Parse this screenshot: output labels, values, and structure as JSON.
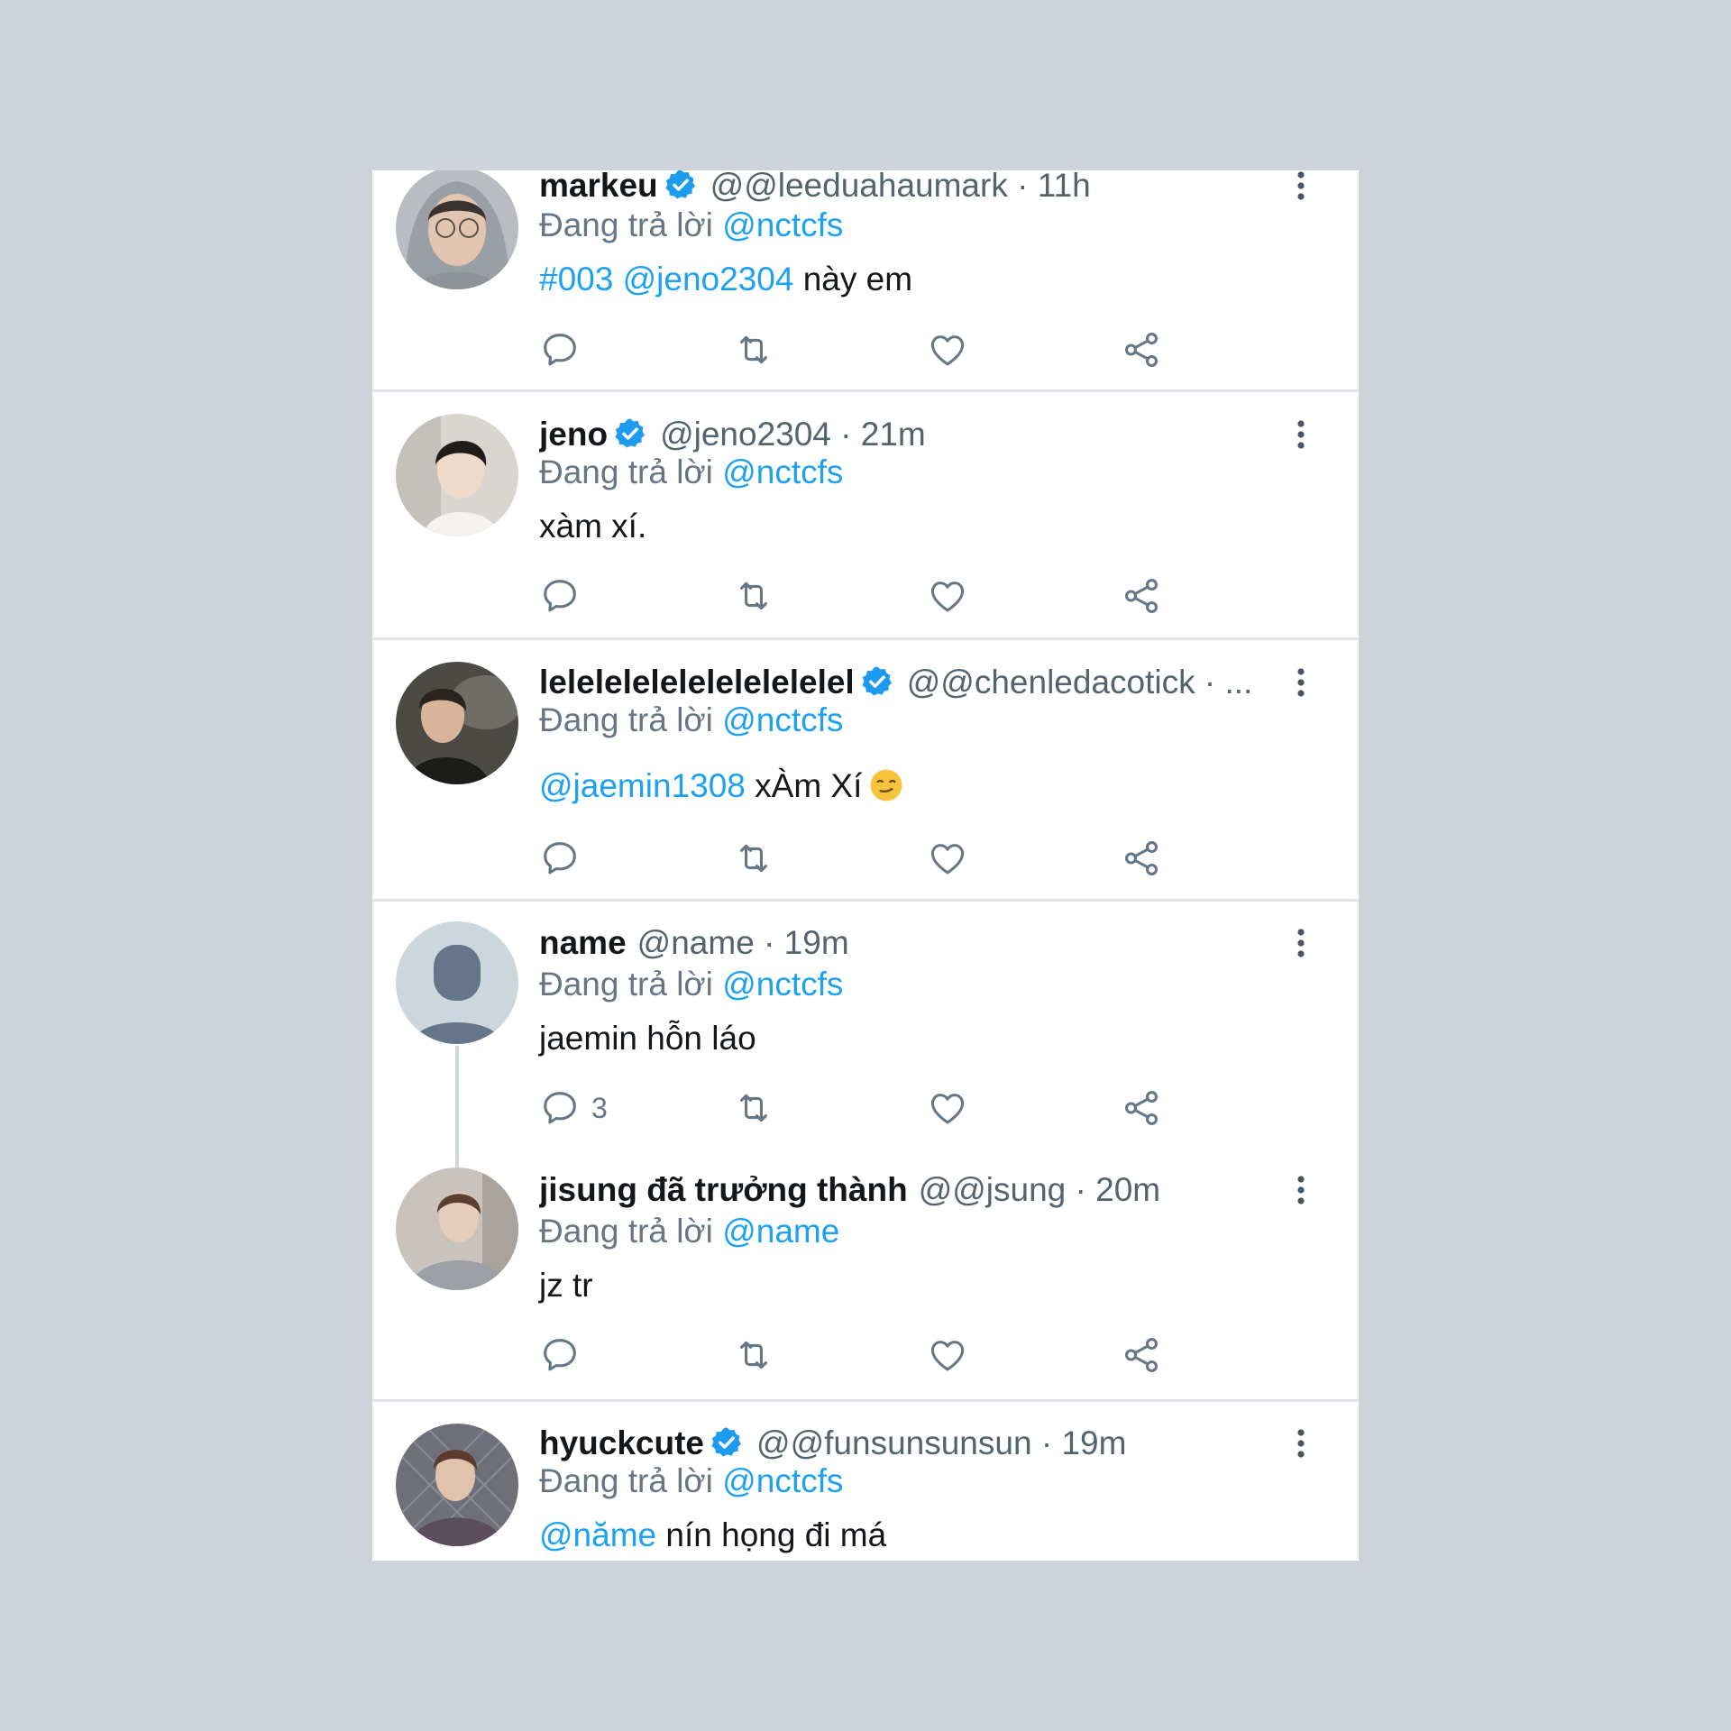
{
  "colors": {
    "link": "#1da1f2",
    "verified": "#1d9bf0",
    "icon": "#657786"
  },
  "tweets": [
    {
      "name": "markeu",
      "verified": true,
      "handle": "@@leeduahaumark",
      "time": "11h",
      "reply_prefix": "Đang trả lời",
      "reply_to": "@nctcfs",
      "body_links": "#003 @jeno2304",
      "body_text": "này em",
      "reply_count": ""
    },
    {
      "name": "jeno",
      "verified": true,
      "handle": "@jeno2304",
      "time": "21m",
      "reply_prefix": "Đang trả lời",
      "reply_to": "@nctcfs",
      "body_links": "",
      "body_text": "xàm xí.",
      "reply_count": ""
    },
    {
      "name": "lelelelelelelelelelelel",
      "verified": true,
      "handle": "@@chenledacotick",
      "time": "...",
      "reply_prefix": "Đang trả lời",
      "reply_to": "@nctcfs",
      "body_links": "@jaemin1308",
      "body_text": "xÀm Xí",
      "reply_count": ""
    },
    {
      "name": "name",
      "verified": false,
      "handle": "@name",
      "time": "19m",
      "reply_prefix": "Đang trả lời",
      "reply_to": "@nctcfs",
      "body_links": "",
      "body_text": "jaemin hỗn láo",
      "reply_count": "3"
    },
    {
      "name": "jisung đã trưởng thành",
      "verified": false,
      "handle": "@@jsung",
      "time": "20m",
      "reply_prefix": "Đang trả lời",
      "reply_to": "@name",
      "body_links": "",
      "body_text": "jz tr",
      "reply_count": ""
    },
    {
      "name": "hyuckcute",
      "verified": true,
      "handle": "@@funsunsunsun",
      "time": "19m",
      "reply_prefix": "Đang trả lời",
      "reply_to": "@nctcfs",
      "body_links": "@năme",
      "body_text": "nín họng đi má",
      "reply_count": ""
    }
  ],
  "icons": [
    "reply-icon",
    "retweet-icon",
    "like-icon",
    "share-icon",
    "more-icon",
    "verified-icon",
    "smirk-emoji-icon"
  ]
}
